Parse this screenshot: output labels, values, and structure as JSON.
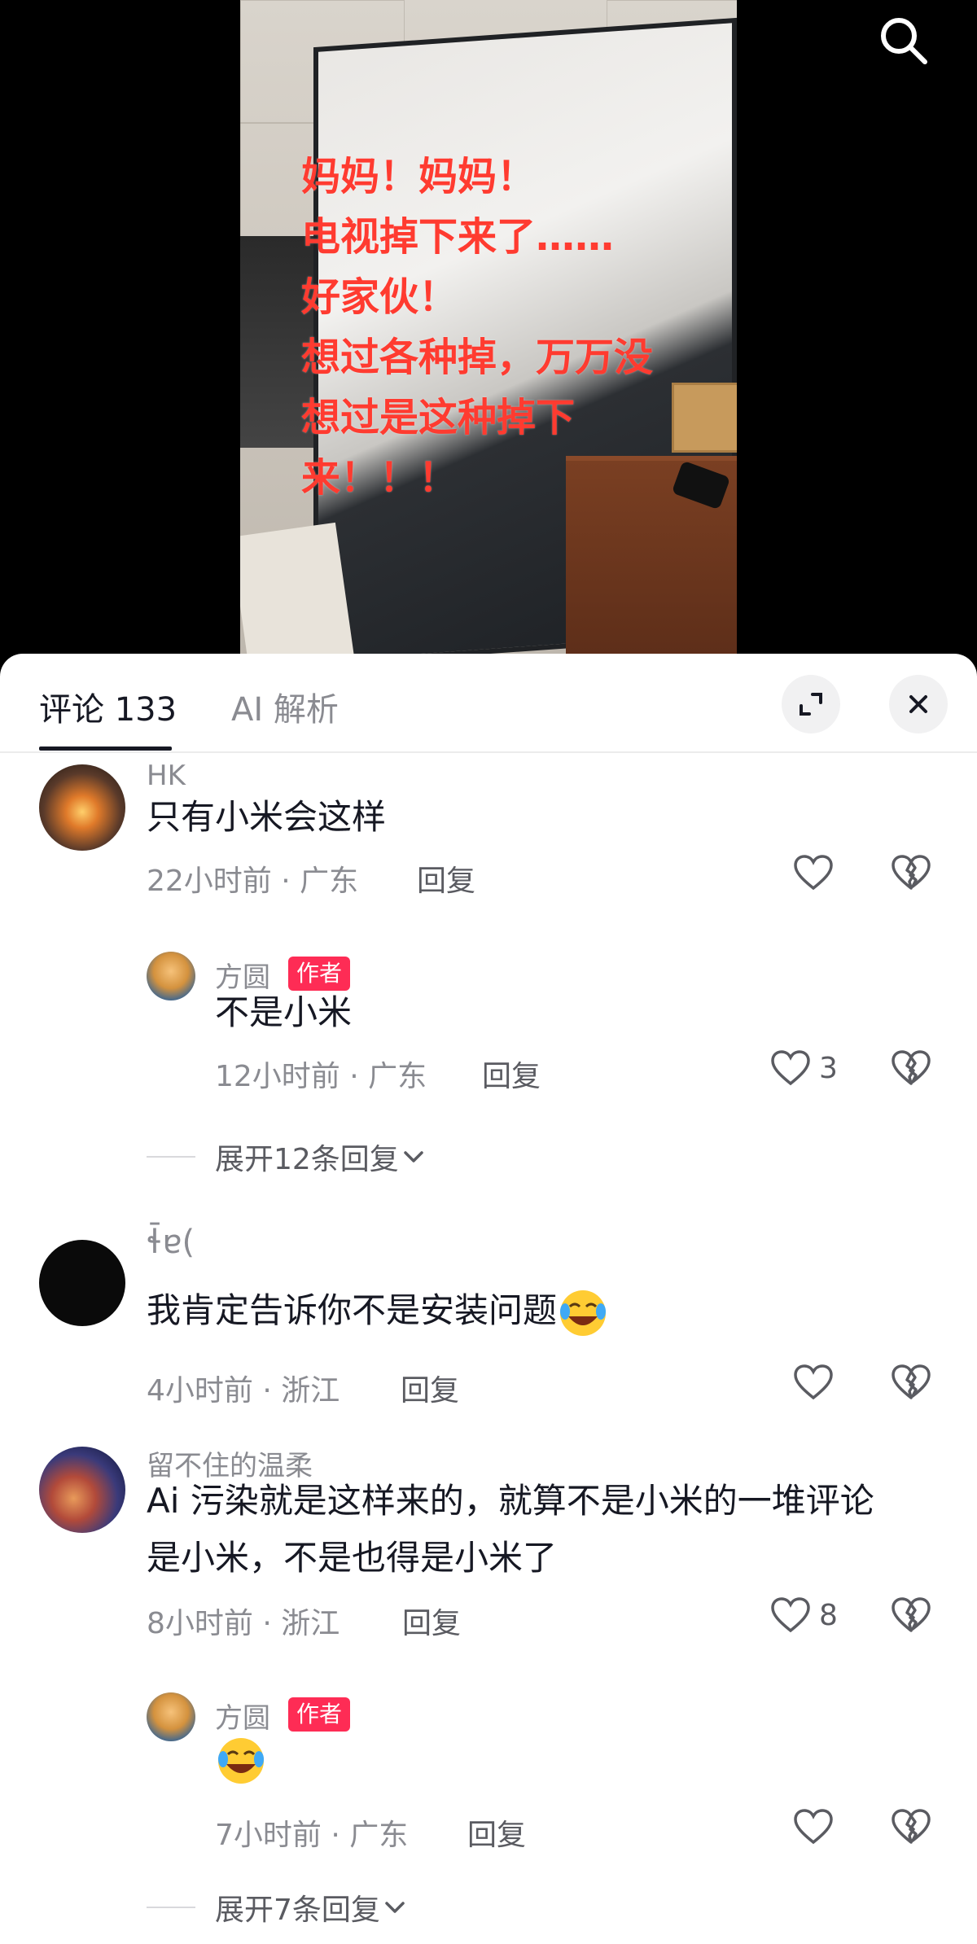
{
  "video": {
    "overlay_text": "妈妈！妈妈！\n电视掉下来了……\n好家伙！\n想过各种掉，万万没\n想过是这种掉下\n来！！！",
    "overlay_color": "#ff3b30"
  },
  "top_icons": {
    "search_icon": "search-icon"
  },
  "tabs": {
    "comments_label": "评论 133",
    "ai_label": "AI 解析"
  },
  "header_icons": {
    "expand_icon": "expand-icon",
    "close_icon": "close-icon"
  },
  "comments": [
    {
      "user": "HK",
      "text": "只有小米会这样",
      "time": "22小时前 · 广东",
      "reply_label": "回复",
      "likes": ""
    },
    {
      "user": "方圆",
      "badge": "作者",
      "text": "不是小米",
      "time": "12小时前 · 广东",
      "reply_label": "回复",
      "likes": "3"
    },
    {
      "expand_label": "展开12条回复"
    },
    {
      "user": "ɬ̄ɐ(",
      "text": "我肯定告诉你不是安装问题",
      "time": "4小时前 · 浙江",
      "reply_label": "回复",
      "likes": ""
    },
    {
      "user": "留不住的温柔",
      "text_line1": "Ai 污染就是这样来的，就算不是小米的一堆评论",
      "text_line2": "是小米，不是也得是小米了",
      "time": "8小时前 · 浙江",
      "reply_label": "回复",
      "likes": "8"
    },
    {
      "user": "方圆",
      "badge": "作者",
      "text": "",
      "time": "7小时前 · 广东",
      "reply_label": "回复",
      "likes": ""
    },
    {
      "expand_label": "展开7条回复"
    }
  ],
  "colors": {
    "accent_badge": "#fe2c55",
    "text_primary": "#161823",
    "text_secondary": "#8a8b91"
  }
}
